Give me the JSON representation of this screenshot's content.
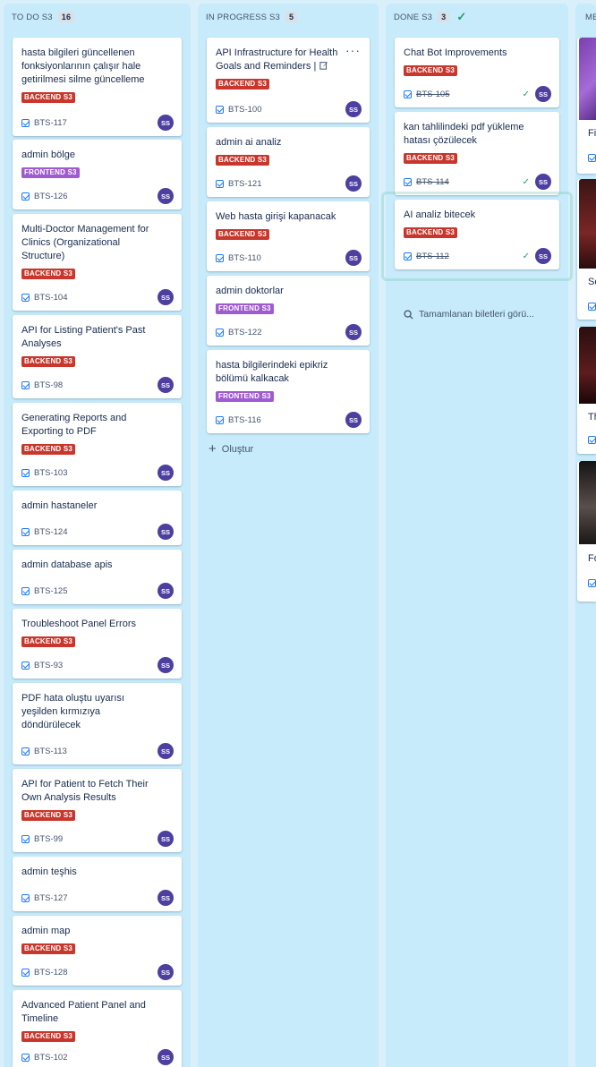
{
  "columns": [
    {
      "title": "TO DO S3",
      "count": "16"
    },
    {
      "title": "IN PROGRESS S3",
      "count": "5"
    },
    {
      "title": "DONE S3",
      "count": "3"
    },
    {
      "title": "ME"
    }
  ],
  "todo": [
    {
      "title": "hasta bilgileri güncellenen fonksiyonlarının çalışır hale getirilmesi silme güncelleme",
      "label": "BACKEND S3",
      "key": "BTS-117"
    },
    {
      "title": "admin bölge",
      "label": "FRONTEND S3",
      "key": "BTS-126"
    },
    {
      "title": "Multi-Doctor Management for Clinics (Organizational Structure)",
      "label": "BACKEND S3",
      "key": "BTS-104"
    },
    {
      "title": "API for Listing Patient's Past Analyses",
      "label": "BACKEND S3",
      "key": "BTS-98"
    },
    {
      "title": "Generating Reports and Exporting to PDF",
      "label": "BACKEND S3",
      "key": "BTS-103"
    },
    {
      "title": "admin hastaneler",
      "label": "",
      "key": "BTS-124"
    },
    {
      "title": "admin database apis",
      "label": "",
      "key": "BTS-125"
    },
    {
      "title": "Troubleshoot Panel Errors",
      "label": "BACKEND S3",
      "key": "BTS-93"
    },
    {
      "title": "PDF hata oluştu uyarısı yeşilden kırmızıya döndürülecek",
      "label": "",
      "key": "BTS-113"
    },
    {
      "title": "API for Patient to Fetch Their Own Analysis Results",
      "label": "BACKEND S3",
      "key": "BTS-99"
    },
    {
      "title": "admin teşhis",
      "label": "",
      "key": "BTS-127"
    },
    {
      "title": "admin map",
      "label": "BACKEND S3",
      "key": "BTS-128"
    },
    {
      "title": "Advanced Patient Panel and Timeline",
      "label": "BACKEND S3",
      "key": "BTS-102"
    }
  ],
  "inprogress": [
    {
      "title": "API Infrastructure for Health Goals and Reminders |",
      "label": "BACKEND S3",
      "key": "BTS-100"
    },
    {
      "title": "admin ai analiz",
      "label": "BACKEND S3",
      "key": "BTS-121"
    },
    {
      "title": "Web hasta girişi kapanacak",
      "label": "BACKEND S3",
      "key": "BTS-110"
    },
    {
      "title": "admin doktorlar",
      "label": "FRONTEND S3",
      "key": "BTS-122"
    },
    {
      "title": "hasta bilgilerindeki epikriz bölümü kalkacak",
      "label": "FRONTEND S3",
      "key": "BTS-116"
    }
  ],
  "done": [
    {
      "title": "Chat Bot Improvements",
      "label": "BACKEND S3",
      "key": "BTS-105"
    },
    {
      "title": "kan tahlilindeki pdf yükleme hatası çözülecek",
      "label": "BACKEND S3",
      "key": "BTS-114"
    },
    {
      "title": "AI analiz bitecek",
      "label": "BACKEND S3",
      "key": "BTS-112"
    }
  ],
  "avatar": "SS",
  "create_label": "Oluştur",
  "done_search_label": "Tamamlanan biletleri görü...",
  "partial_cards": [
    "Fi",
    "Se",
    "Th",
    "Fo"
  ],
  "colors": {
    "backend": "#c9372c",
    "frontend": "#9f5bd1",
    "column_bg": "#c7ebfa",
    "avatar": "#4c3fa0"
  }
}
